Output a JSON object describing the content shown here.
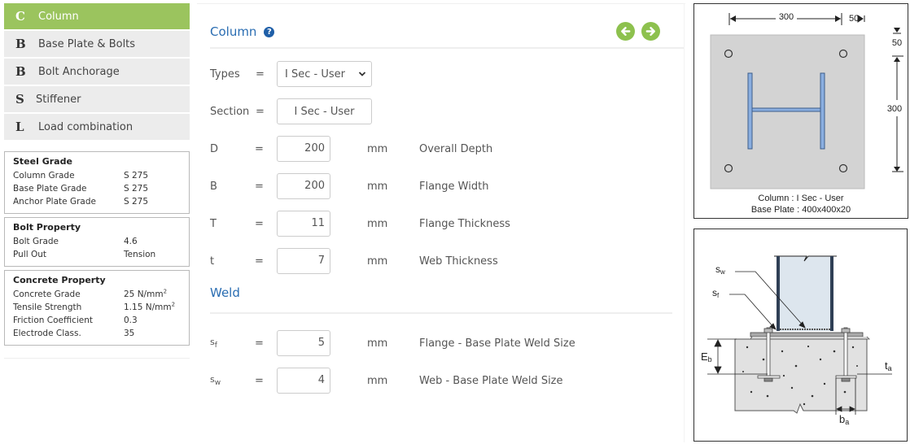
{
  "sidebar": {
    "nav": [
      {
        "letter": "C",
        "label": "Column",
        "active": true
      },
      {
        "letter": "B",
        "label": "Base Plate & Bolts",
        "active": false
      },
      {
        "letter": "B",
        "label": "Bolt Anchorage",
        "active": false
      },
      {
        "letter": "S",
        "label": "Stiffener",
        "active": false
      },
      {
        "letter": "L",
        "label": "Load combination",
        "active": false
      }
    ],
    "steel_grade": {
      "title": "Steel Grade",
      "rows": [
        {
          "key": "Column Grade",
          "value": "S 275"
        },
        {
          "key": "Base Plate Grade",
          "value": "S 275"
        },
        {
          "key": "Anchor Plate Grade",
          "value": "S 275"
        }
      ]
    },
    "bolt_property": {
      "title": "Bolt Property",
      "rows": [
        {
          "key": "Bolt Grade",
          "value": "4.6"
        },
        {
          "key": "Pull Out",
          "value": "Tension"
        }
      ]
    },
    "concrete_property": {
      "title": "Concrete Property",
      "rows": [
        {
          "key": "Concrete Grade",
          "value": "25 N/mm",
          "sup": "2"
        },
        {
          "key": "Tensile Strength",
          "value": "1.15 N/mm",
          "sup": "2"
        },
        {
          "key": "Friction Coefficient",
          "value": "0.3"
        },
        {
          "key": "Electrode Class.",
          "value": "35"
        }
      ]
    }
  },
  "main": {
    "column_title": "Column",
    "help_glyph": "?",
    "nav_prev": "arrow-left-icon",
    "nav_next": "arrow-right-icon",
    "types": {
      "label": "Types",
      "eq": "=",
      "value": "I Sec - User"
    },
    "section": {
      "label": "Section",
      "eq": "=",
      "value": "I Sec - User"
    },
    "dims": [
      {
        "symbol": "D",
        "eq": "=",
        "value": "200",
        "unit": "mm",
        "desc": "Overall Depth"
      },
      {
        "symbol": "B",
        "eq": "=",
        "value": "200",
        "unit": "mm",
        "desc": "Flange Width"
      },
      {
        "symbol": "T",
        "eq": "=",
        "value": "11",
        "unit": "mm",
        "desc": "Flange Thickness"
      },
      {
        "symbol": "t",
        "eq": "=",
        "value": "7",
        "unit": "mm",
        "desc": "Web Thickness"
      }
    ],
    "weld_title": "Weld",
    "welds": [
      {
        "symbol": "s",
        "sub": "f",
        "eq": "=",
        "value": "5",
        "unit": "mm",
        "desc": "Flange - Base Plate Weld Size"
      },
      {
        "symbol": "s",
        "sub": "w",
        "eq": "=",
        "value": "4",
        "unit": "mm",
        "desc": "Web - Base Plate Weld Size"
      }
    ]
  },
  "plan_diagram": {
    "dim_top": "300",
    "dim_top_edge": "50",
    "dim_right_edge": "50",
    "dim_right": "300",
    "caption_line1": "Column : I Sec - User",
    "caption_line2": "Base Plate : 400x400x20"
  },
  "section_diagram": {
    "label_sw": "s",
    "label_sw_sub": "w",
    "label_sf": "s",
    "label_sf_sub": "f",
    "label_eb": "E",
    "label_eb_sub": "b",
    "label_ta": "t",
    "label_ta_sub": "a",
    "label_ba": "b",
    "label_ba_sub": "a"
  }
}
